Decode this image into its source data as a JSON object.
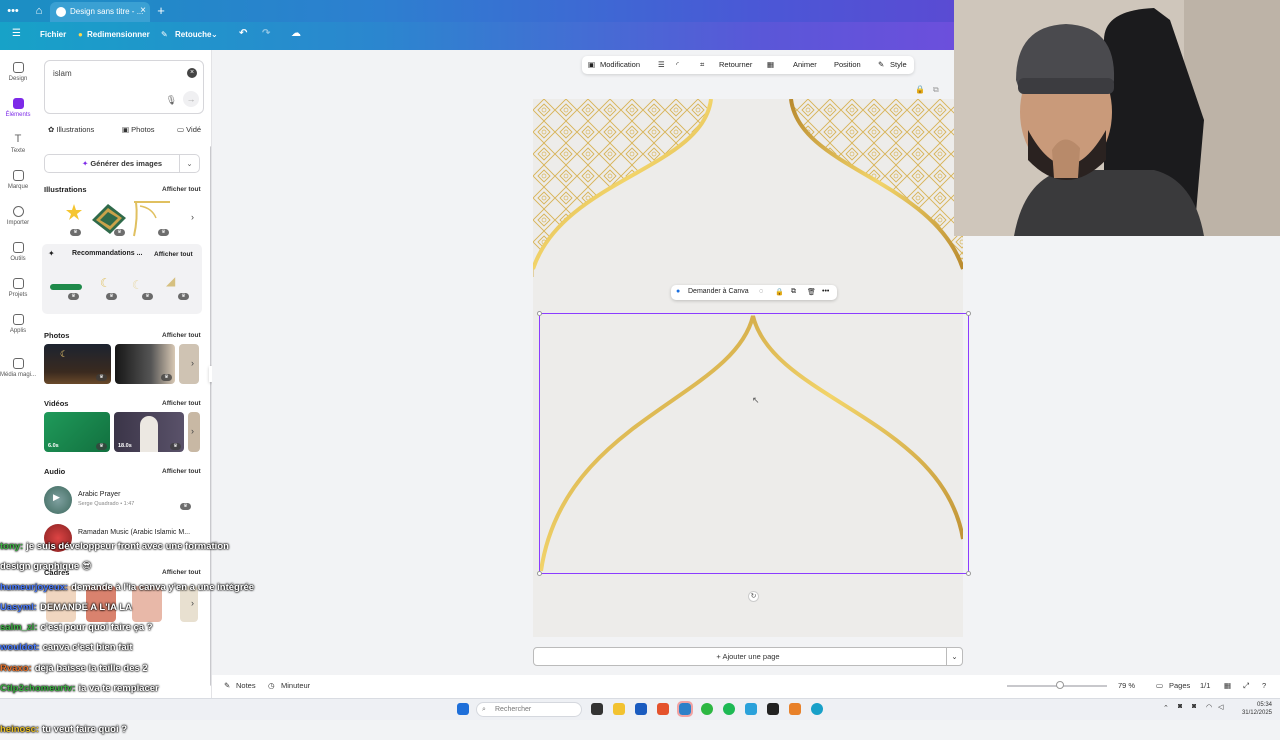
{
  "browser": {
    "tab_title": "Design sans titre - ...",
    "tab_close": "×",
    "new_tab": "+"
  },
  "header": {
    "menu": "Fichier",
    "resize": "Redimensionner",
    "retouch": "Retouche"
  },
  "rail": {
    "items": [
      {
        "label": "Design"
      },
      {
        "label": "Éléments"
      },
      {
        "label": "Texte"
      },
      {
        "label": "Marque"
      },
      {
        "label": "Importer"
      },
      {
        "label": "Outils"
      },
      {
        "label": "Projets"
      },
      {
        "label": "Applis"
      },
      {
        "label": "Média magi..."
      }
    ]
  },
  "panel": {
    "search_value": "islam",
    "filters": [
      "Illustrations",
      "Photos",
      "Vidé"
    ],
    "generate_label": "Générer des images",
    "see_all": "Afficher tout",
    "sections": {
      "illustrations": "Illustrations",
      "recommendations": "Recommandations ...",
      "photos": "Photos",
      "videos": "Vidéos",
      "audio": "Audio",
      "frames": "Cadres"
    },
    "videos": [
      {
        "duration": "6.0s"
      },
      {
        "duration": "18.0s"
      }
    ],
    "audio": [
      {
        "title": "Arabic Prayer",
        "meta": "Serge Quadrado • 1:47"
      },
      {
        "title": "Ramadan Music (Arabic Islamic M...",
        "meta": ""
      }
    ]
  },
  "toolbar": {
    "edit": "Modification",
    "flip": "Retourner",
    "animate": "Animer",
    "position": "Position",
    "style": "Style"
  },
  "canvas": {
    "ask_canva": "Demander à Canva",
    "add_page": "+ Ajouter une page"
  },
  "bottombar": {
    "notes": "Notes",
    "timer": "Minuteur",
    "zoom": "79 %",
    "pages_label": "Pages",
    "page_count": "1/1"
  },
  "chat": [
    {
      "user": "tony:",
      "text": "je suis développeur front avec une formation",
      "color": "#3cb043"
    },
    {
      "user": "",
      "text": "design graphique 😎",
      "color": "#ffffff"
    },
    {
      "user": "humeurjoyeux:",
      "text": "demande à l'ia canva y'en a une intégrée",
      "color": "#4a7cff"
    },
    {
      "user": "Uasyml:",
      "text": "DEMANDE A L'IA LA",
      "color": "#4a7cff"
    },
    {
      "user": "salm_zi:",
      "text": "c'est pour quoi faire ça ?",
      "color": "#3cb043"
    },
    {
      "user": "wouldot:",
      "text": "canva c'est bien fait",
      "color": "#4a7cff"
    },
    {
      "user": "Rvaxo:",
      "text": "déjà baisse la taille des 2",
      "color": "#e8722a"
    },
    {
      "user": "Ctlp2chomeurtv:",
      "text": "ia va te remplacer",
      "color": "#3cb043"
    },
    {
      "user": "",
      "text": "mdrrrrrrrrrrrrrrrrrrrrrrrrrrrrrrrrrrr",
      "color": "#ffffff"
    },
    {
      "user": "heinosc:",
      "text": "tu veut faire quoi ?",
      "color": "#e8c02a"
    }
  ],
  "taskbar": {
    "search_placeholder": "Rechercher",
    "time": "05:34",
    "date": "31/12/2025"
  }
}
